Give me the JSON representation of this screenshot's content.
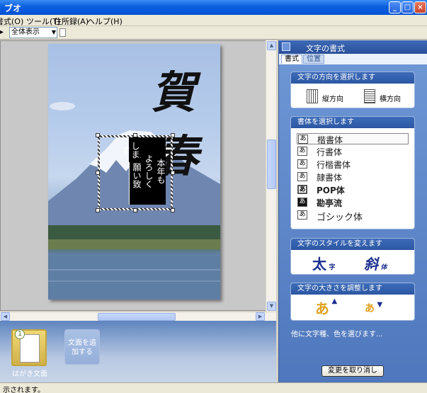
{
  "window": {
    "title": "ブオ",
    "minimize": "_",
    "maximize": "□",
    "close": "×"
  },
  "menu": [
    "書式(O)",
    "ツール(T)",
    "住所録(A)",
    "ヘルプ(H)"
  ],
  "toolbar": {
    "view_value": "全体表示"
  },
  "card": {
    "greeting_1": "賀",
    "greeting_2": "春",
    "message_cols": [
      "本年も",
      "よろしく",
      "お願い致",
      "します"
    ]
  },
  "strip": {
    "thumb_number": "1",
    "thumb_label": "はがき文面",
    "add_label": "文面を追加する"
  },
  "panel": {
    "title": "文字の書式",
    "tabs": {
      "format": "書式",
      "position": "位置"
    },
    "direction": {
      "title": "文字の方向を選択します",
      "vertical": "縦方向",
      "horizontal": "横方向"
    },
    "fonts": {
      "title": "書体を選択します",
      "items": [
        {
          "glyph": "あ",
          "name": "楷書体"
        },
        {
          "glyph": "あ",
          "name": "行書体"
        },
        {
          "glyph": "あ",
          "name": "行楷書体"
        },
        {
          "glyph": "あ",
          "name": "隷書体"
        },
        {
          "glyph": "あ",
          "name": "POP体"
        },
        {
          "glyph": "あ",
          "name": "勘亭流"
        },
        {
          "glyph": "あ",
          "name": "ゴシック体"
        }
      ]
    },
    "style": {
      "title": "文字のスタイルを変えます",
      "bold_main": "太",
      "bold_sub": "字",
      "italic_main": "斜",
      "italic_sub": "体"
    },
    "size": {
      "title": "文字の大きさを調整します",
      "larger": "あ",
      "larger_arrow": "▲",
      "smaller": "あ",
      "smaller_arrow": "▼"
    },
    "note": "他に文字種、色を選びます...",
    "undo": "変更を取り消し"
  },
  "status": "示されます。",
  "colors": {
    "panel_blue": "#4f77bd",
    "title_blue": "#0a5fe0",
    "accent_text": "#2848a8"
  }
}
